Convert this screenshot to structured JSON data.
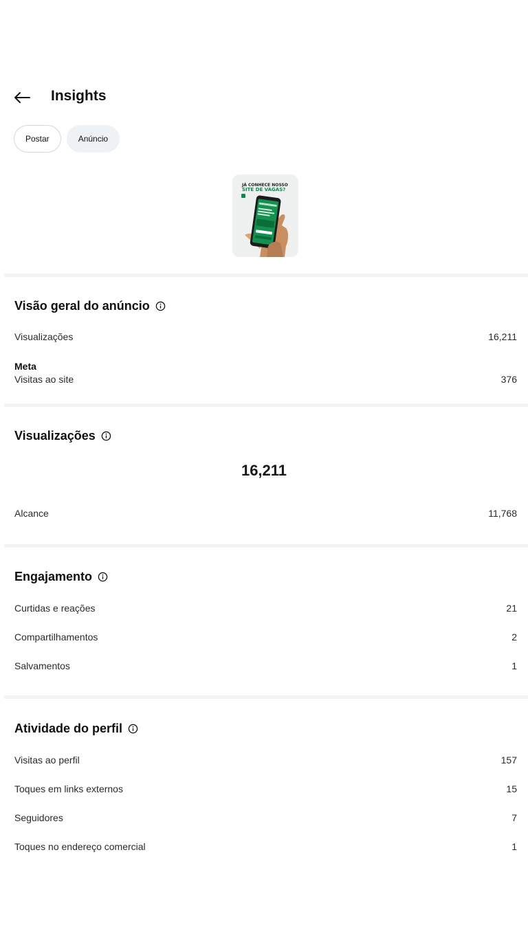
{
  "header": {
    "title": "Insights"
  },
  "tabs": [
    {
      "label": "Postar"
    },
    {
      "label": "Anúncio"
    }
  ],
  "thumbnail": {
    "headline_line1": "JÁ CONHECE NOSSO",
    "headline_line2": "SITE DE VAGAS?"
  },
  "overview": {
    "title": "Visão geral do anúncio",
    "views_label": "Visualizações",
    "views_value": "16,211",
    "meta_label": "Meta",
    "site_visits_label": "Visitas ao site",
    "site_visits_value": "376"
  },
  "views": {
    "title": "Visualizações",
    "total": "16,211",
    "reach_label": "Alcance",
    "reach_value": "11,768"
  },
  "engagement": {
    "title": "Engajamento",
    "rows": [
      {
        "label": "Curtidas e reações",
        "value": "21"
      },
      {
        "label": "Compartilhamentos",
        "value": "2"
      },
      {
        "label": "Salvamentos",
        "value": "1"
      }
    ]
  },
  "profile": {
    "title": "Atividade do perfil",
    "rows": [
      {
        "label": "Visitas ao perfil",
        "value": "157"
      },
      {
        "label": "Toques em links externos",
        "value": "15"
      },
      {
        "label": "Seguidores",
        "value": "7"
      },
      {
        "label": "Toques no endereço comercial",
        "value": "1"
      }
    ]
  },
  "colors": {
    "accent_green": "#0c8a4a",
    "divider": "#f3f5f4",
    "chip_fill": "#eff2f5"
  }
}
